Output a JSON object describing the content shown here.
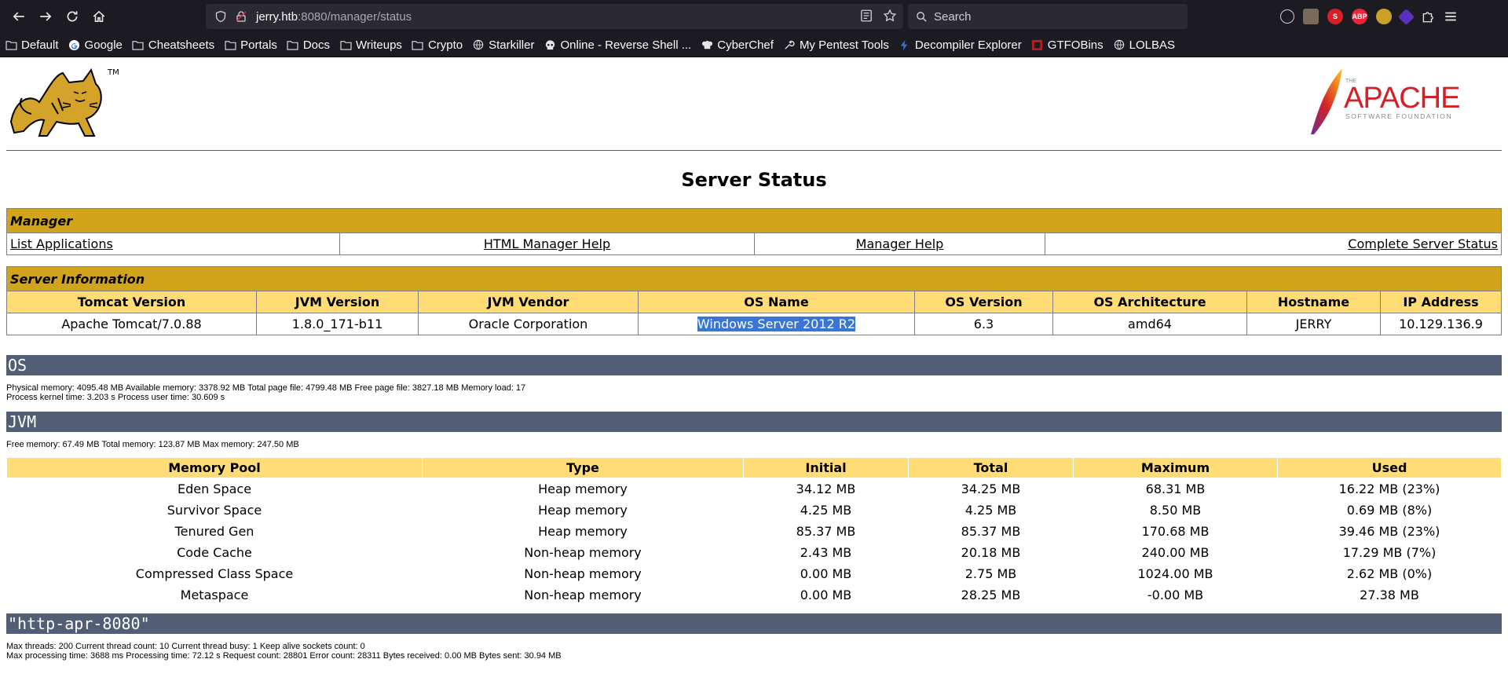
{
  "browser": {
    "url_host": "jerry.htb",
    "url_path": ":8080/manager/status",
    "search_placeholder": "Search"
  },
  "bookmarks": [
    {
      "label": "Default",
      "icon": "folder-icon"
    },
    {
      "label": "Google",
      "icon": "google-icon"
    },
    {
      "label": "Cheatsheets",
      "icon": "folder-icon"
    },
    {
      "label": "Portals",
      "icon": "folder-icon"
    },
    {
      "label": "Docs",
      "icon": "folder-icon"
    },
    {
      "label": "Writeups",
      "icon": "folder-icon"
    },
    {
      "label": "Crypto",
      "icon": "folder-icon"
    },
    {
      "label": "Starkiller",
      "icon": "globe-icon"
    },
    {
      "label": "Online - Reverse Shell ...",
      "icon": "skull-icon"
    },
    {
      "label": "CyberChef",
      "icon": "chef-icon"
    },
    {
      "label": "My Pentest Tools",
      "icon": "tools-icon"
    },
    {
      "label": "Decompiler Explorer",
      "icon": "dogbolt-icon"
    },
    {
      "label": "GTFOBins",
      "icon": "gtfobins-icon"
    },
    {
      "label": "LOLBAS",
      "icon": "globe-icon"
    }
  ],
  "logos": {
    "tm": "TM",
    "apache_the": "THE",
    "apache_name": "APACHE",
    "apache_sub": "SOFTWARE FOUNDATION"
  },
  "page": {
    "title": "Server Status",
    "manager": {
      "heading": "Manager",
      "links": [
        "List Applications",
        "HTML Manager Help",
        "Manager Help",
        "Complete Server Status"
      ]
    },
    "server_info": {
      "heading": "Server Information",
      "headers": [
        "Tomcat Version",
        "JVM Version",
        "JVM Vendor",
        "OS Name",
        "OS Version",
        "OS Architecture",
        "Hostname",
        "IP Address"
      ],
      "values": [
        "Apache Tomcat/7.0.88",
        "1.8.0_171-b11",
        "Oracle Corporation",
        "Windows Server 2012 R2",
        "6.3",
        "amd64",
        "JERRY",
        "10.129.136.9"
      ]
    },
    "os": {
      "heading": "OS",
      "line1": "Physical memory: 4095.48 MB Available memory: 3378.92 MB Total page file: 4799.48 MB Free page file: 3827.18 MB Memory load: 17",
      "line2": "Process kernel time: 3.203 s Process user time: 30.609 s"
    },
    "jvm": {
      "heading": "JVM",
      "line1": "Free memory: 67.49 MB Total memory: 123.87 MB Max memory: 247.50 MB",
      "headers": [
        "Memory Pool",
        "Type",
        "Initial",
        "Total",
        "Maximum",
        "Used"
      ],
      "rows": [
        [
          "Eden Space",
          "Heap memory",
          "34.12 MB",
          "34.25 MB",
          "68.31 MB",
          "16.22 MB (23%)"
        ],
        [
          "Survivor Space",
          "Heap memory",
          "4.25 MB",
          "4.25 MB",
          "8.50 MB",
          "0.69 MB (8%)"
        ],
        [
          "Tenured Gen",
          "Heap memory",
          "85.37 MB",
          "85.37 MB",
          "170.68 MB",
          "39.46 MB (23%)"
        ],
        [
          "Code Cache",
          "Non-heap memory",
          "2.43 MB",
          "20.18 MB",
          "240.00 MB",
          "17.29 MB (7%)"
        ],
        [
          "Compressed Class Space",
          "Non-heap memory",
          "0.00 MB",
          "2.75 MB",
          "1024.00 MB",
          "2.62 MB (0%)"
        ],
        [
          "Metaspace",
          "Non-heap memory",
          "0.00 MB",
          "28.25 MB",
          "-0.00 MB",
          "27.38 MB"
        ]
      ]
    },
    "connector": {
      "heading": "\"http-apr-8080\"",
      "line1": "Max threads: 200 Current thread count: 10 Current thread busy: 1 Keep alive sockets count: 0",
      "line2": "Max processing time: 3688 ms Processing time: 72.12 s Request count: 28801 Error count: 28311 Bytes received: 0.00 MB Bytes sent: 30.94 MB"
    }
  }
}
